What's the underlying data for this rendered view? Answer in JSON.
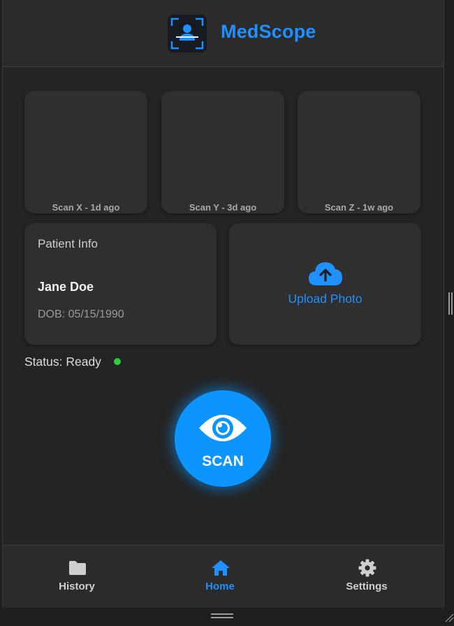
{
  "header": {
    "title": "MedScope",
    "logo_icon": "person-scan-icon",
    "accent": "#1e90ff"
  },
  "recent_scans": [
    {
      "label": "Scan X - 1d ago"
    },
    {
      "label": "Scan Y - 3d ago"
    },
    {
      "label": "Scan Z - 1w ago"
    }
  ],
  "patient": {
    "section_title": "Patient Info",
    "name": "Jane Doe",
    "dob": "DOB: 05/15/1990"
  },
  "upload": {
    "label": "Upload Photo",
    "icon": "cloud-upload-icon"
  },
  "status": {
    "text": "Status: Ready",
    "color": "#2ecc40"
  },
  "scan_button": {
    "label": "SCAN",
    "icon": "eye-icon",
    "color": "#0d95ff"
  },
  "nav": {
    "items": [
      {
        "label": "History",
        "icon": "folder-icon",
        "active": false
      },
      {
        "label": "Home",
        "icon": "home-icon",
        "active": true
      },
      {
        "label": "Settings",
        "icon": "gear-icon",
        "active": false
      }
    ],
    "active_color": "#1e90ff",
    "inactive_color": "#cfcfcf"
  }
}
